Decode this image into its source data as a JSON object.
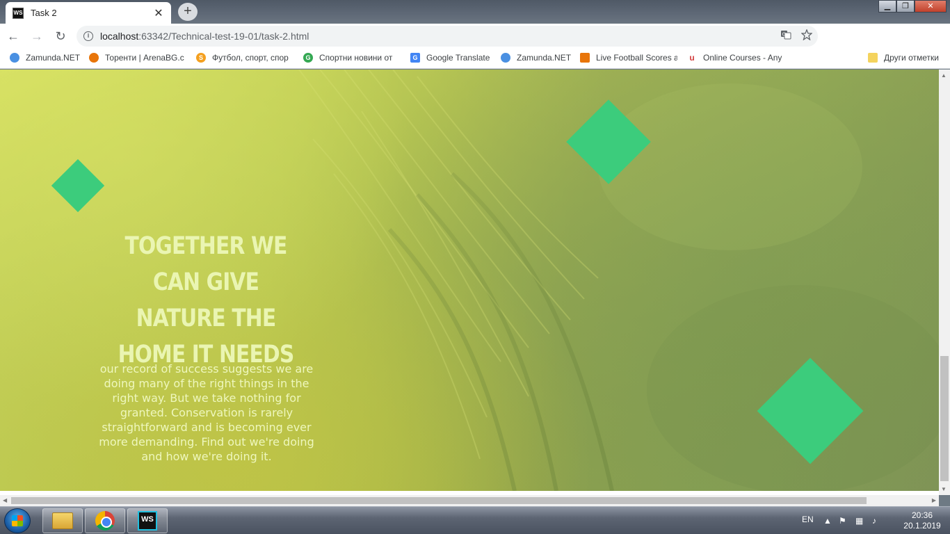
{
  "browser": {
    "tab": {
      "title": "Task 2",
      "favicon_text": "WS",
      "close_glyph": "✕"
    },
    "new_tab_glyph": "+",
    "window_controls": {
      "minimize": "▁",
      "maximize": "❐",
      "close": "✕"
    },
    "url": {
      "host": "localhost",
      "rest": ":63342/Technical-test-19-01/task-2.html"
    },
    "nav": {
      "back": "←",
      "forward": "→",
      "reload": "↻"
    },
    "omnibox_icons": [
      "translate-icon",
      "star-icon"
    ],
    "bookmarks": [
      {
        "label": "Zamunda.NET",
        "color": "#4a90e2"
      },
      {
        "label": "Торенти | ArenaBG.c",
        "color": "#e8750a"
      },
      {
        "label": "Футбол, спорт, спор",
        "color": "#f4a020"
      },
      {
        "label": "Спортни новини от",
        "color": "#34a853"
      },
      {
        "label": "Google Translate",
        "color": "#4285f4"
      },
      {
        "label": "Zamunda.NET",
        "color": "#4a90e2"
      },
      {
        "label": "Live Football Scores a",
        "color": "#e8750a"
      },
      {
        "label": "Online Courses - Any",
        "color": "#d23c3c"
      },
      {
        "label": "Други отметки",
        "color": "#f4d35e"
      }
    ]
  },
  "page": {
    "heading": "Together we can give nature the home it needs",
    "body": "our record of success suggests we are doing many of the right things in the right way. But we take nothing for granted. Conservation is rarely straightforward and is becoming ever more demanding. Find out we're doing and how we're doing it.",
    "accent_color": "#3ccc7c"
  },
  "taskbar": {
    "apps": [
      "windows-explorer",
      "google-chrome",
      "webstorm"
    ],
    "webstorm_label": "WS",
    "language": "EN",
    "time": "20:36",
    "date": "20.1.2019 г."
  }
}
